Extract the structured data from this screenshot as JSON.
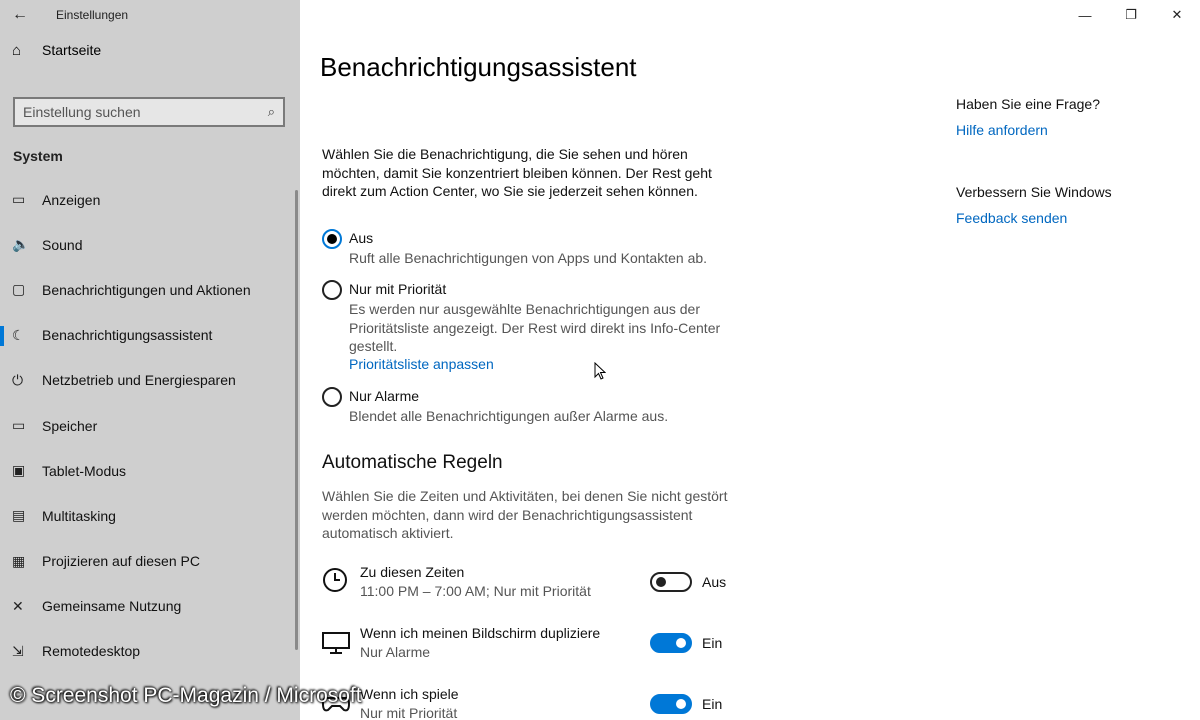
{
  "window": {
    "app_title": "Einstellungen",
    "back_icon": "back-arrow-icon",
    "controls": {
      "minimize": "—",
      "restore": "❐",
      "close": "✕"
    }
  },
  "sidebar": {
    "home_label": "Startseite",
    "search_placeholder": "Einstellung suchen",
    "section": "System",
    "items": [
      {
        "label": "Anzeigen",
        "icon": "monitor-icon",
        "glyph": "▭"
      },
      {
        "label": "Sound",
        "icon": "speaker-icon",
        "glyph": "🔈"
      },
      {
        "label": "Benachrichtigungen und Aktionen",
        "icon": "notification-icon",
        "glyph": "▢"
      },
      {
        "label": "Benachrichtigungsassistent",
        "icon": "moon-icon",
        "glyph": "☾"
      },
      {
        "label": "Netzbetrieb und Energiesparen",
        "icon": "power-icon",
        "glyph": "⏻"
      },
      {
        "label": "Speicher",
        "icon": "storage-icon",
        "glyph": "▭"
      },
      {
        "label": "Tablet-Modus",
        "icon": "tablet-icon",
        "glyph": "▣"
      },
      {
        "label": "Multitasking",
        "icon": "multitasking-icon",
        "glyph": "▤"
      },
      {
        "label": "Projizieren auf diesen PC",
        "icon": "project-icon",
        "glyph": "▦"
      },
      {
        "label": "Gemeinsame Nutzung",
        "icon": "share-icon",
        "glyph": "✕"
      },
      {
        "label": "Remotedesktop",
        "icon": "remote-icon",
        "glyph": "⇲"
      }
    ]
  },
  "main": {
    "title": "Benachrichtigungsassistent",
    "intro": "Wählen Sie die Benachrichtigung, die Sie sehen und hören möchten, damit Sie konzentriert bleiben können. Der Rest geht direkt zum Action Center, wo Sie sie jederzeit sehen können.",
    "options": [
      {
        "label": "Aus",
        "desc": "Ruft alle Benachrichtigungen von Apps und Kontakten ab.",
        "checked": true
      },
      {
        "label": "Nur mit Priorität",
        "desc": "Es werden nur ausgewählte Benachrichtigungen aus der Prioritätsliste angezeigt. Der Rest wird direkt ins Info-Center gestellt.",
        "link": "Prioritätsliste anpassen",
        "checked": false
      },
      {
        "label": "Nur Alarme",
        "desc": "Blendet alle Benachrichtigungen außer Alarme aus.",
        "checked": false
      }
    ],
    "rules_heading": "Automatische Regeln",
    "rules_desc": "Wählen Sie die Zeiten und Aktivitäten, bei denen Sie nicht gestört werden möchten, dann wird der Benachrichtigungsassistent automatisch aktiviert.",
    "rules": [
      {
        "title": "Zu diesen Zeiten",
        "sub": "11:00 PM – 7:00 AM; Nur mit Priorität",
        "state": "Aus",
        "on": false,
        "icon": "clock-icon"
      },
      {
        "title": "Wenn ich meinen Bildschirm dupliziere",
        "sub": "Nur Alarme",
        "state": "Ein",
        "on": true,
        "icon": "monitor-icon"
      },
      {
        "title": "Wenn ich spiele",
        "sub": "Nur mit Priorität",
        "state": "Ein",
        "on": true,
        "icon": "gamepad-icon"
      }
    ]
  },
  "aside": {
    "question": "Haben Sie eine Frage?",
    "help_link": "Hilfe anfordern",
    "improve": "Verbessern Sie Windows",
    "feedback_link": "Feedback senden"
  },
  "watermark": "© Screenshot PC-Magazin / Microsoft",
  "colors": {
    "accent": "#0078d7",
    "link": "#0067c0",
    "sidebar_bg": "#cfcfcf"
  }
}
